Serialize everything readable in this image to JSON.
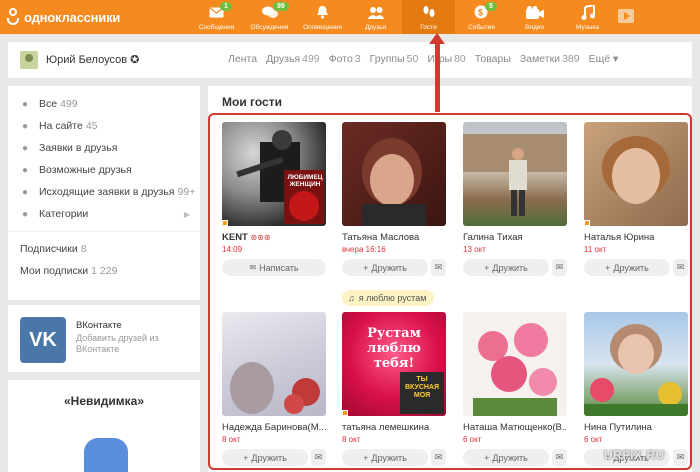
{
  "brand": {
    "name": "одноклассники"
  },
  "nav": [
    {
      "label": "Сообщения",
      "badge": "1",
      "icon": "envelope-icon"
    },
    {
      "label": "Обсуждения",
      "badge": "99",
      "icon": "chat-bubbles-icon"
    },
    {
      "label": "Оповещения",
      "badge": "",
      "icon": "bell-icon"
    },
    {
      "label": "Друзья",
      "badge": "",
      "icon": "friends-icon"
    },
    {
      "label": "Гости",
      "badge": "",
      "icon": "footprints-icon"
    },
    {
      "label": "События",
      "badge": "5",
      "icon": "events-icon"
    },
    {
      "label": "Видео",
      "badge": "",
      "icon": "video-camera-icon"
    },
    {
      "label": "Музыка",
      "badge": "",
      "icon": "music-note-icon"
    }
  ],
  "profile": {
    "name": "Юрий Белоусов ✪"
  },
  "tabs": [
    {
      "label": "Лента",
      "count": ""
    },
    {
      "label": "Друзья",
      "count": "499"
    },
    {
      "label": "Фото",
      "count": "3"
    },
    {
      "label": "Группы",
      "count": "50"
    },
    {
      "label": "Игры",
      "count": "80"
    },
    {
      "label": "Товары",
      "count": ""
    },
    {
      "label": "Заметки",
      "count": "389"
    },
    {
      "label": "Ещё ▾",
      "count": ""
    }
  ],
  "sidebar": {
    "items": [
      {
        "label": "Все",
        "count": "499",
        "icon": "people-icon"
      },
      {
        "label": "На сайте",
        "count": "45",
        "icon": "person-online-icon"
      },
      {
        "label": "Заявки в друзья",
        "count": "",
        "icon": "person-add-icon"
      },
      {
        "label": "Возможные друзья",
        "count": "",
        "icon": "person-search-icon"
      },
      {
        "label": "Исходящие заявки в друзья",
        "count": "99+",
        "icon": "person-outgoing-icon"
      },
      {
        "label": "Категории",
        "count": "",
        "icon": "people-icon"
      }
    ],
    "subscribers": {
      "label": "Подписчики",
      "count": "8"
    },
    "subscriptions": {
      "label": "Мои подписки",
      "count": "1 229"
    },
    "vk": {
      "logo": "VK",
      "title": "ВКонтакте",
      "desc": "Добавить друзей из ВКонтакте"
    },
    "invisible": {
      "title": "«Невидимка»"
    }
  },
  "guests_title": "Мои гости",
  "song_badge": "я люблю рустам",
  "guests": [
    {
      "name": "KENT",
      "extra": "⊛⊛⊛",
      "time": "14:09",
      "action": "Написать"
    },
    {
      "name": "Татьяна Маслова",
      "extra": "",
      "time": "вчера 16:16",
      "action": "Дружить"
    },
    {
      "name": "Галина Тихая",
      "extra": "",
      "time": "13 окт",
      "action": "Дружить"
    },
    {
      "name": "Наталья Юрина",
      "extra": "",
      "time": "11 окт",
      "action": "Дружить"
    },
    {
      "name": "Надежда Баринова(М...",
      "extra": "",
      "time": "8 окт",
      "action": "Дружить"
    },
    {
      "name": "татьяна лемешкина",
      "extra": "",
      "time": "8 окт",
      "action": "Дружить"
    },
    {
      "name": "Наташа Матющенко(В...",
      "extra": "",
      "time": "6 окт",
      "action": "Дружить"
    },
    {
      "name": "Нина Путилина",
      "extra": "",
      "time": "6 окт",
      "action": "Дружить"
    }
  ],
  "photo_captions": {
    "kent": "ЛЮБИМЕЦ ЖЕНЩИН",
    "rustam": "Рустам люблю тебя!",
    "moya": "ТЫ ВКУСНАЯ МОЯ"
  },
  "watermark": "URFIX.RU",
  "colors": {
    "brand": "#f58a1f",
    "highlight": "#d23a2f",
    "time": "#e2323a",
    "vk": "#4a76a8"
  }
}
